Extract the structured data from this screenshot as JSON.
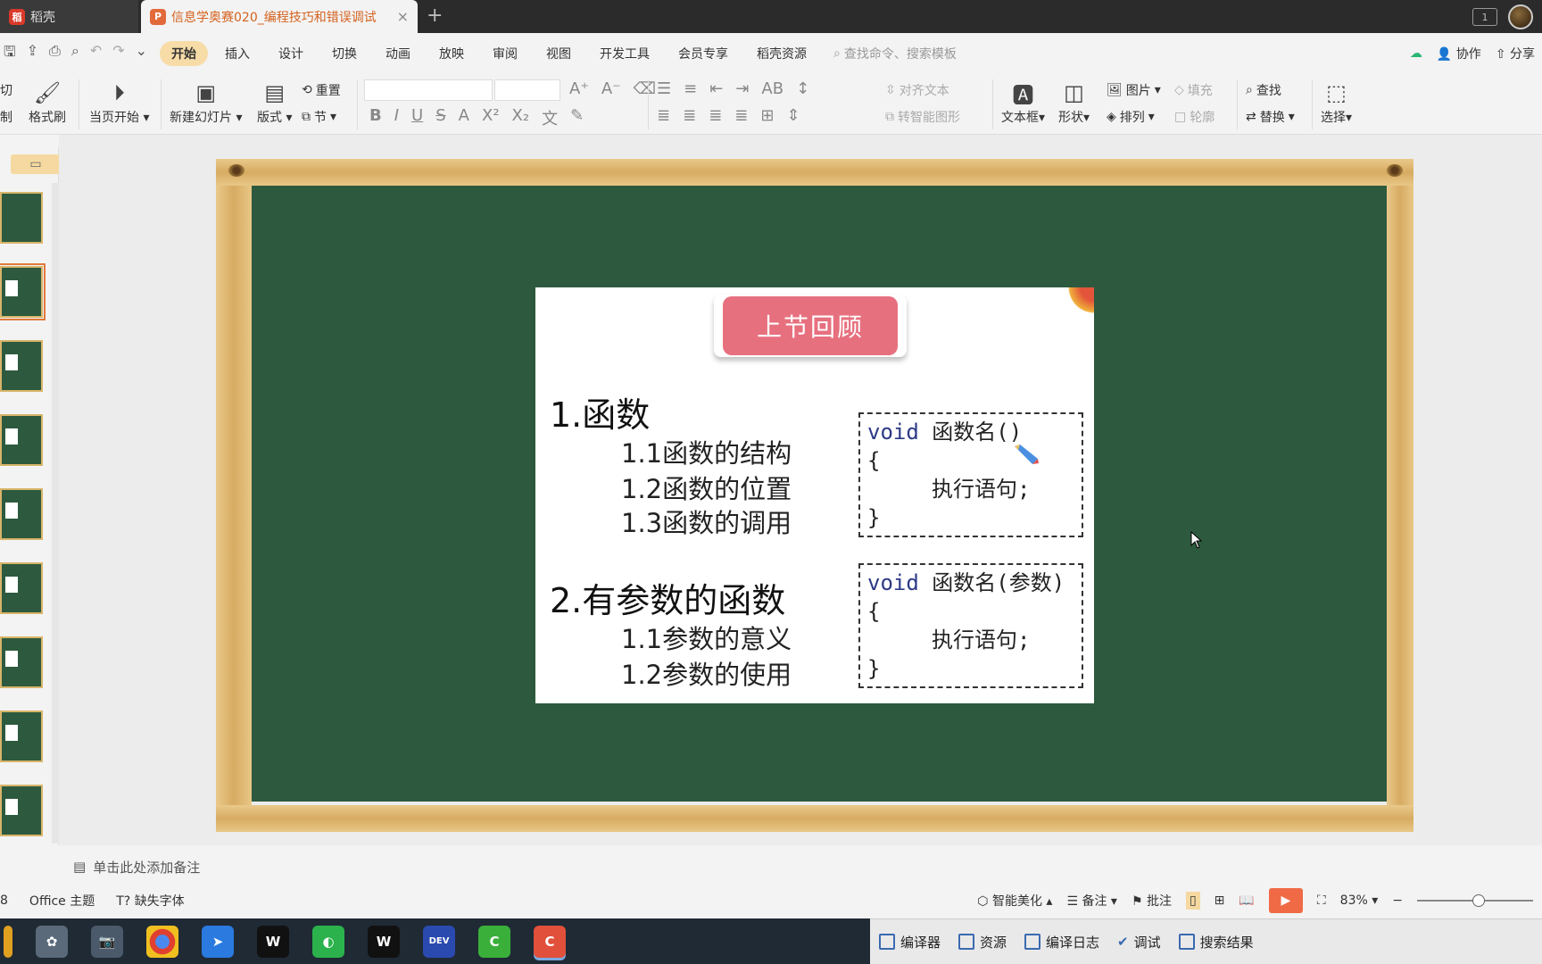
{
  "titlebar": {
    "home_tab": "稻壳",
    "doc_tab": "信息学奥赛020_编程技巧和错误调试",
    "close_glyph": "×",
    "new_tab_glyph": "+"
  },
  "menu": {
    "items": [
      "开始",
      "插入",
      "设计",
      "切换",
      "动画",
      "放映",
      "审阅",
      "视图",
      "开发工具",
      "会员专享",
      "稻壳资源"
    ],
    "active": "开始",
    "search_placeholder": "查找命令、搜索模板",
    "collab": "协作",
    "share": "分享"
  },
  "ribbon": {
    "cut": "剪切",
    "copy": "复制",
    "format_painter": "格式刷",
    "play_from_current": "当页开始",
    "new_slide": "新建幻灯片",
    "layout": "版式",
    "reset": "重置",
    "section": "节",
    "align_text": "对齐文本",
    "to_smartart": "转智能图形",
    "textbox": "文本框",
    "shape": "形状",
    "picture": "图片",
    "arrange": "排列",
    "fill": "填充",
    "outline": "轮廓",
    "find": "查找",
    "replace": "替换",
    "select": "选择"
  },
  "slide": {
    "title": "上节回顾",
    "section1": "1.函数",
    "section1_items": [
      "1.1函数的结构",
      "1.2函数的位置",
      "1.3函数的调用"
    ],
    "section2": "2.有参数的函数",
    "section2_items": [
      "1.1参数的意义",
      "1.2参数的使用"
    ],
    "code1": {
      "kw": "void",
      "sig": "函数名()",
      "open": "{",
      "body": "执行语句;",
      "close": "}"
    },
    "code2": {
      "kw": "void",
      "sig": "函数名(参数)",
      "open": "{",
      "body": "执行语句;",
      "close": "}"
    }
  },
  "notes": {
    "placeholder": "单击此处添加备注"
  },
  "status": {
    "page": "8",
    "theme": "Office 主题",
    "missing_font": "缺失字体",
    "smart_beautify": "智能美化",
    "notes": "备注",
    "comment": "批注",
    "zoom": "83%"
  },
  "devpanel": {
    "items": [
      "编译器",
      "资源",
      "编译日志",
      "调试",
      "搜索结果"
    ]
  },
  "taskbar": {
    "icons": [
      "folder-icon",
      "app-icon",
      "camera-icon",
      "chrome-icon",
      "feishu-icon",
      "wps-writer-icon",
      "wechat-icon",
      "wps-writer-icon",
      "devcpp-icon",
      "cmaker-icon",
      "cmaker-red-icon"
    ]
  },
  "colors": {
    "board": "#2d5a3e",
    "title_badge": "#e7707f",
    "active_tab": "#f7dca7",
    "accent_orange": "#d4621f"
  }
}
